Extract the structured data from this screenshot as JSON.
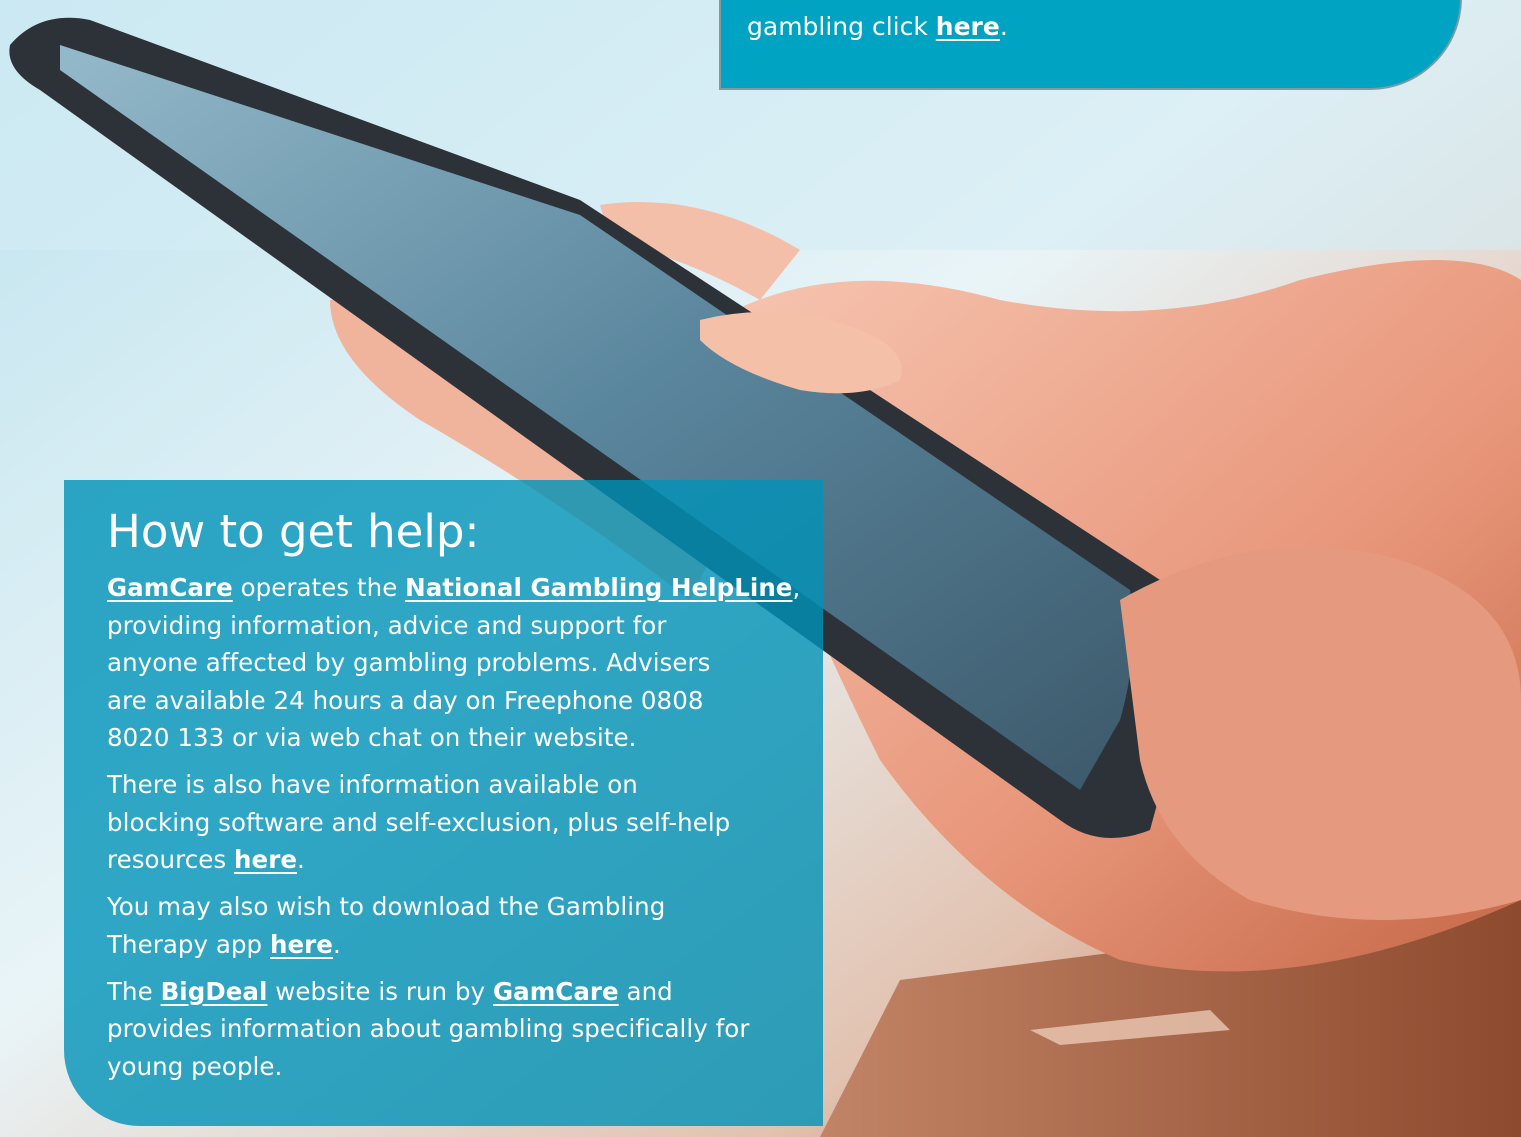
{
  "top_callout": {
    "text_before": "gambling click ",
    "link": "here",
    "text_after": "."
  },
  "help": {
    "title": "How to get help:",
    "p1": {
      "link1": "GamCare",
      "mid": " operates the ",
      "link2": "National Gambling HelpLine",
      "after": ",",
      "lines": [
        "providing information, advice and support for",
        "anyone affected by gambling problems. Advisers",
        "are available 24 hours a day on Freephone 0808",
        "8020 133 or via web chat on their website."
      ]
    },
    "p2": {
      "lines": [
        "There is also have information available on",
        "blocking software and self-exclusion, plus self-help"
      ],
      "prefix": "resources ",
      "link": "here",
      "after": "."
    },
    "p3": {
      "line1": "You may also wish to download the Gambling",
      "prefix": "Therapy app ",
      "link": "here",
      "after": "."
    },
    "p4": {
      "prefix": "The ",
      "link1": "BigDeal",
      "mid": " website is run by ",
      "link2": "GamCare",
      "after": " and",
      "lines": [
        "provides information about gambling specifically for",
        "young people."
      ]
    }
  },
  "colors": {
    "callout_teal": "#00a3c1",
    "panel_teal": "#0092b8",
    "text": "#ffffff"
  }
}
